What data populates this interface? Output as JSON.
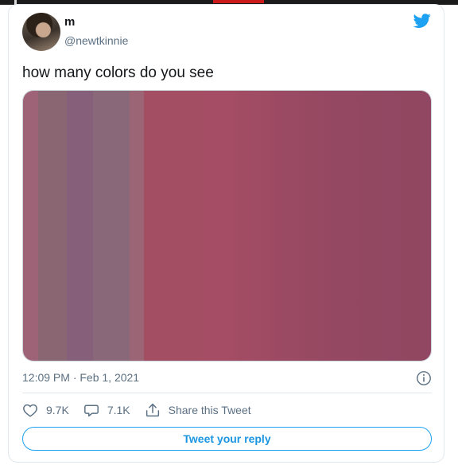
{
  "tweet": {
    "author_name": "m",
    "author_handle": "@newtkinnie",
    "text": "how many colors do you see",
    "timestamp": "12:09 PM · Feb 1, 2021",
    "likes": "9.7K",
    "replies": "7.1K",
    "share_label": "Share this Tweet",
    "reply_button_label": "Tweet your reply"
  },
  "icons": {
    "brand": "twitter-bird-icon",
    "info": "info-icon",
    "like": "heart-icon",
    "reply": "speech-bubble-icon",
    "share": "share-upload-icon"
  },
  "colors": {
    "twitter_blue": "#1da1f2",
    "muted_text": "#5b7083",
    "border": "#e1e8ed",
    "image_stripes": [
      "#9e6376",
      "#8a6673",
      "#86607a",
      "#89687a",
      "#9b6575",
      "#a44e64",
      "#914761"
    ]
  }
}
